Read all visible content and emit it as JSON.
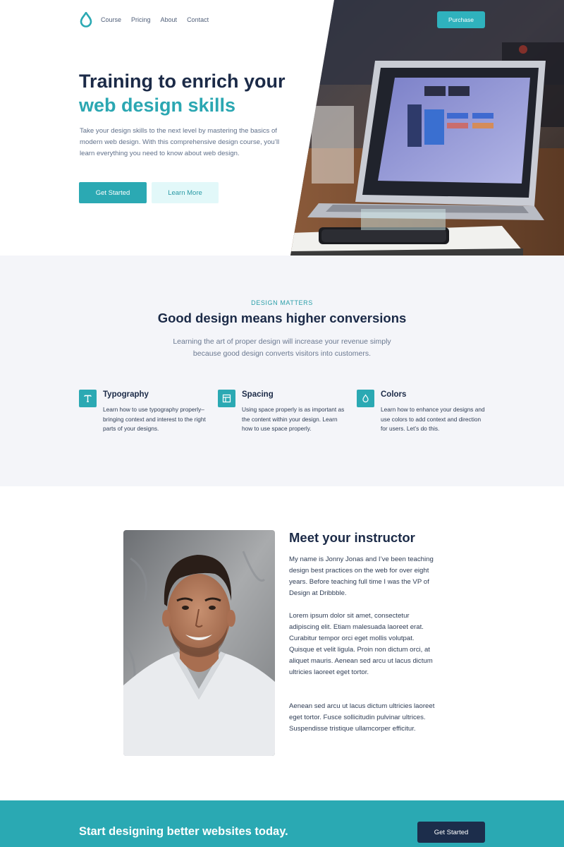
{
  "nav": {
    "links": [
      "Course",
      "Pricing",
      "About",
      "Contact"
    ],
    "purchase_label": "Purchase",
    "logo_icon": "droplet-icon"
  },
  "hero": {
    "title_line1": "Training to enrich your",
    "title_line2": "web design skills",
    "description": "Take your design skills to the next level by mastering the basics of modern web design. With this comprehensive design course, you’ll learn everything you need to know about web design.",
    "primary_label": "Get Started",
    "secondary_label": "Learn More",
    "photo_icon": "laptop-photo"
  },
  "features": {
    "eyebrow": "DESIGN MATTERS",
    "title": "Good design means higher conversions",
    "subtitle": "Learning the art of proper design will increase your revenue simply because good design converts visitors into customers.",
    "items": [
      {
        "title": "Typography",
        "text": "Learn how to use typography properly–bringing context and interest to the right parts of your designs.",
        "icon": "type-icon"
      },
      {
        "title": "Spacing",
        "text": "Using space properly is as important as the content within your design. Learn how to use space properly.",
        "icon": "layout-icon"
      },
      {
        "title": "Colors",
        "text": "Learn how to enhance your designs and use colors to add context and direction for users. Let’s do this.",
        "icon": "droplet-icon"
      }
    ]
  },
  "instructor": {
    "title": "Meet your instructor",
    "paragraphs": [
      "My name is Jonny Jonas and I’ve been teaching design best practices on the web for over eight years. Before teaching full time I was the VP of Design at Dribbble.",
      "Lorem ipsum dolor sit amet, consectetur adipiscing elit. Etiam malesuada laoreet erat. Curabitur tempor orci eget mollis volutpat. Quisque et velit ligula. Proin non dictum orci, at aliquet mauris. Aenean sed arcu ut lacus dictum ultricies laoreet eget tortor.",
      "Aenean sed arcu ut lacus dictum ultricies laoreet eget tortor. Fusce sollicitudin pulvinar ultrices. Suspendisse tristique ullamcorper efficitur."
    ]
  },
  "cta": {
    "text": "Start designing better websites today.",
    "button_label": "Get Started"
  },
  "colors": {
    "accent": "#2ba9b3",
    "navy": "#1b2a47",
    "section_bg": "#f4f5f9"
  }
}
